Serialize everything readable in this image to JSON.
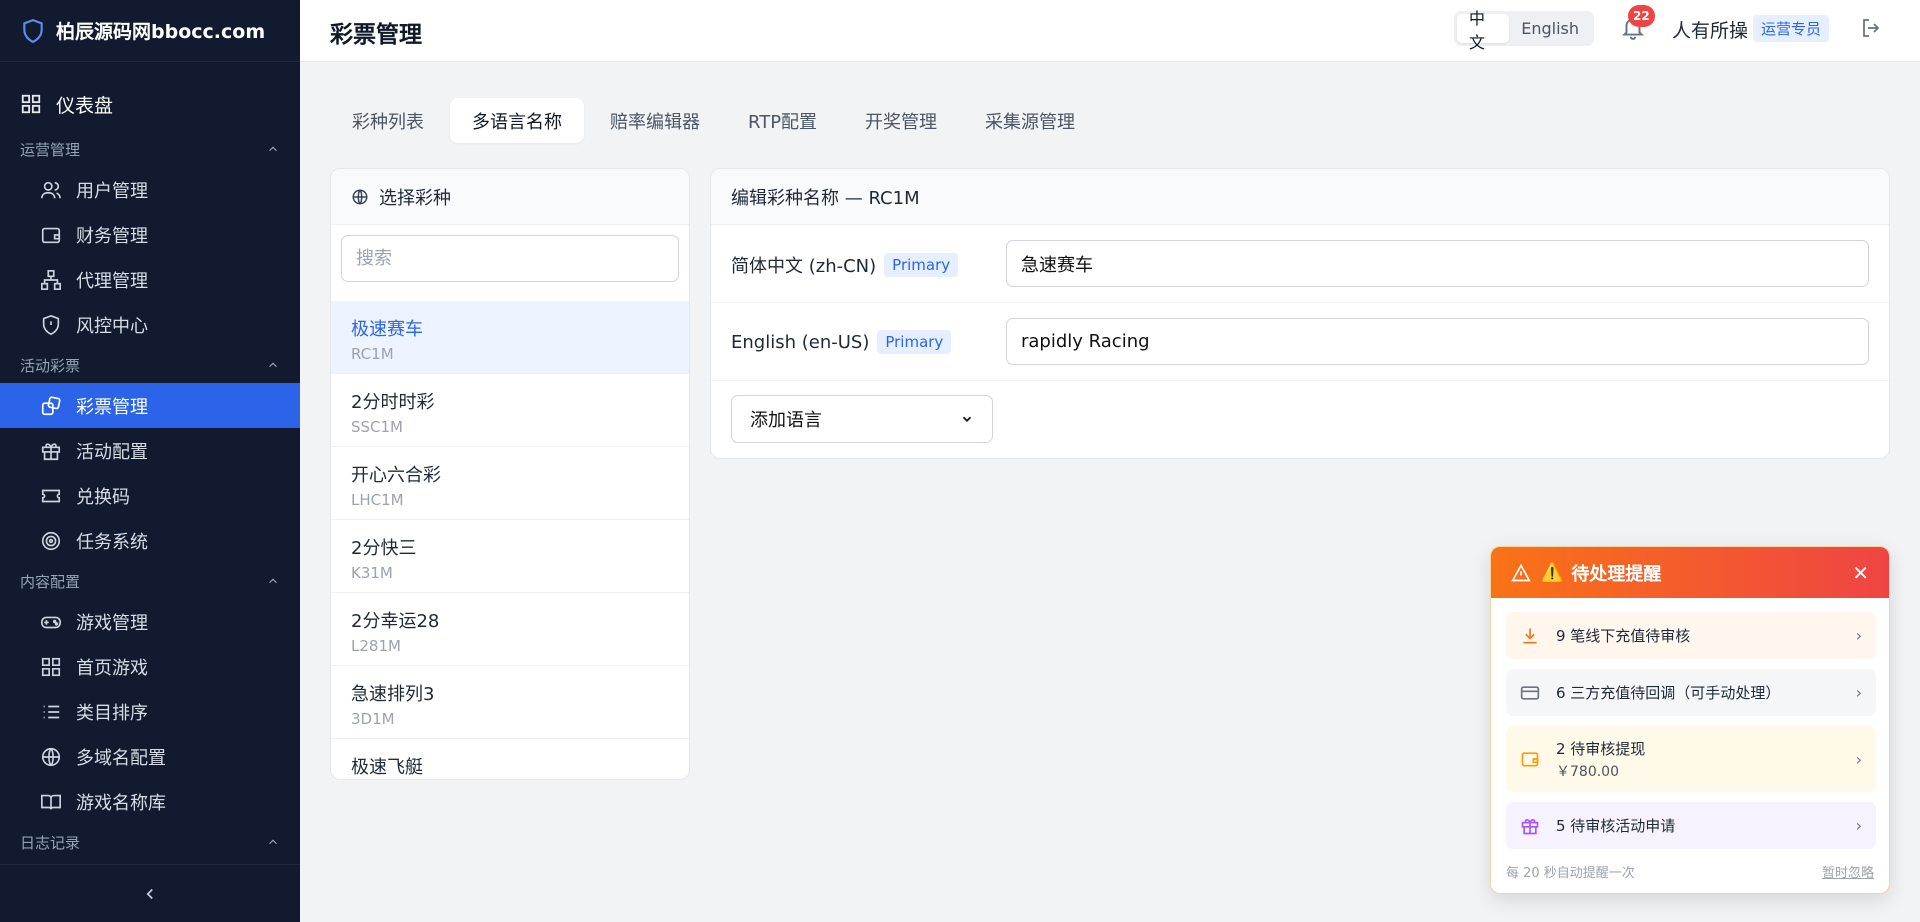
{
  "brand": {
    "name": "柏辰源码网bbocc.com"
  },
  "sidebar": {
    "dashboard": "仪表盘",
    "groups": [
      {
        "title": "运营管理",
        "items": [
          "用户管理",
          "财务管理",
          "代理管理",
          "风控中心"
        ]
      },
      {
        "title": "活动彩票",
        "items": [
          "彩票管理",
          "活动配置",
          "兑换码",
          "任务系统"
        ]
      },
      {
        "title": "内容配置",
        "items": [
          "游戏管理",
          "首页游戏",
          "类目排序",
          "多域名配置",
          "游戏名称库"
        ]
      },
      {
        "title": "日志记录",
        "items": []
      }
    ],
    "active": "彩票管理"
  },
  "header": {
    "title": "彩票管理",
    "lang_zh": "中文",
    "lang_en": "English",
    "notification_count": "22",
    "user_name": "人有所操",
    "role": "运营专员"
  },
  "tabs": [
    "彩种列表",
    "多语言名称",
    "赔率编辑器",
    "RTP配置",
    "开奖管理",
    "采集源管理"
  ],
  "active_tab": "多语言名称",
  "lottery_panel": {
    "title": "选择彩种",
    "search_placeholder": "搜索",
    "items": [
      {
        "name": "极速赛车",
        "code": "RC1M"
      },
      {
        "name": "2分时时彩",
        "code": "SSC1M"
      },
      {
        "name": "开心六合彩",
        "code": "LHC1M"
      },
      {
        "name": "2分快三",
        "code": "K31M"
      },
      {
        "name": "2分幸运28",
        "code": "L281M"
      },
      {
        "name": "急速排列3",
        "code": "3D1M"
      },
      {
        "name": "极速飞艇",
        "code": ""
      }
    ]
  },
  "editor": {
    "title": "编辑彩种名称 — RC1M",
    "rows": [
      {
        "label": "简体中文 (zh-CN)",
        "badge": "Primary",
        "value": "急速赛车"
      },
      {
        "label": "English (en-US)",
        "badge": "Primary",
        "value": "rapidly Racing"
      }
    ],
    "add_language": "添加语言"
  },
  "notification": {
    "title": "待处理提醒",
    "emoji": "⚠️",
    "items": [
      {
        "text": "9 笔线下充值待审核",
        "sub": "",
        "icon": "download-icon",
        "bg": "#fff6ee",
        "icon_color": "#f97316"
      },
      {
        "text": "6 三方充值待回调（可手动处理）",
        "sub": "",
        "icon": "card-icon",
        "bg": "#f5f6f8",
        "icon_color": "#6b7280"
      },
      {
        "text": "2 待审核提现",
        "sub": "￥780.00",
        "icon": "wallet-icon",
        "bg": "#fef9e8",
        "icon_color": "#f59e0b"
      },
      {
        "text": "5 待审核活动申请",
        "sub": "",
        "icon": "gift-icon",
        "bg": "#f7f3fe",
        "icon_color": "#a855f7"
      }
    ],
    "footer_note": "每 20 秒自动提醒一次",
    "ignore": "暂时忽略"
  },
  "colors": {
    "accent": "#2c64e9",
    "sidebar_bg": "#111a2e",
    "alert_start": "#f97316",
    "alert_end": "#ef4444"
  }
}
